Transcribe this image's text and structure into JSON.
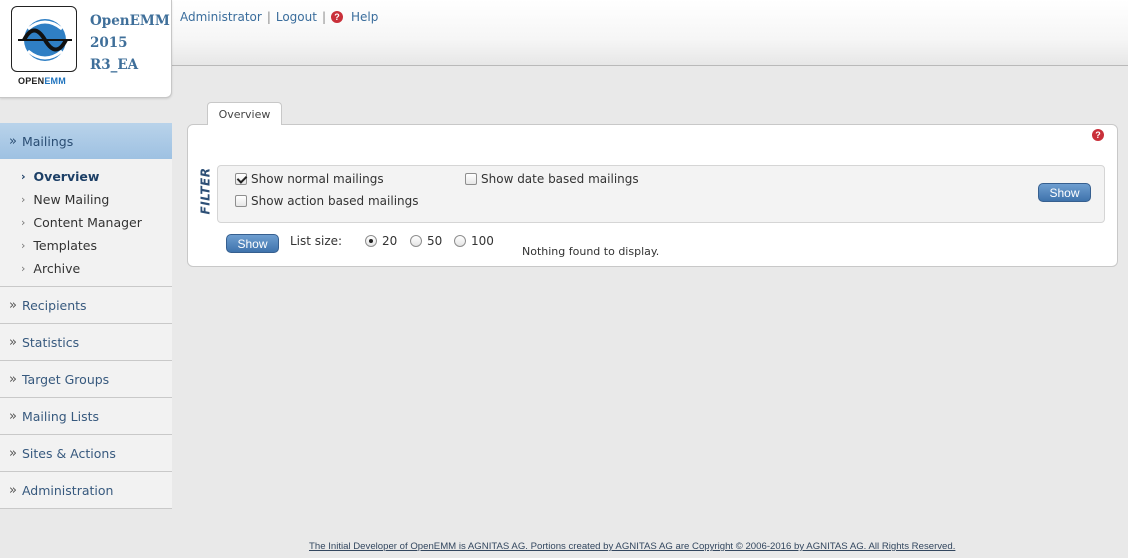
{
  "app": {
    "logo_alt_text": "OPENEMM",
    "logo_brand_prefix": "OPEN",
    "logo_brand_suffix": "EMM",
    "version_lines": [
      "OpenEMM",
      "2015",
      "R3_EA"
    ]
  },
  "userbar": {
    "user": "Administrator",
    "logout": "Logout",
    "help": "Help",
    "help_icon": "?"
  },
  "sidebar": {
    "items": [
      {
        "label": "Mailings",
        "active": true
      },
      {
        "label": "Recipients"
      },
      {
        "label": "Statistics"
      },
      {
        "label": "Target Groups"
      },
      {
        "label": "Mailing Lists"
      },
      {
        "label": "Sites & Actions"
      },
      {
        "label": "Administration"
      }
    ],
    "subitems": [
      {
        "label": "Overview",
        "active": true
      },
      {
        "label": "New Mailing"
      },
      {
        "label": "Content Manager"
      },
      {
        "label": "Templates"
      },
      {
        "label": "Archive"
      }
    ]
  },
  "main": {
    "tab": "Overview",
    "filter_title": "FILTER",
    "filters": {
      "normal": {
        "label": "Show normal mailings",
        "checked": true
      },
      "date": {
        "label": "Show date based mailings",
        "checked": false
      },
      "action": {
        "label": "Show action based mailings",
        "checked": false
      }
    },
    "filter_show_button": "Show",
    "show_button": "Show",
    "list_size_label": "List size:",
    "list_size_options": [
      "20",
      "50",
      "100"
    ],
    "list_size_selected": "20",
    "empty_message": "Nothing found to display."
  },
  "footer": {
    "text": "The Initial Developer of OpenEMM is AGNITAS AG. Portions created by AGNITAS AG are Copyright © 2006-2016 by AGNITAS AG. All Rights Reserved."
  },
  "colors": {
    "accent": "#3f73ac",
    "nav_active": "#9ec1e2",
    "help_red": "#c9303a",
    "title_blue": "#3f6f9a"
  }
}
